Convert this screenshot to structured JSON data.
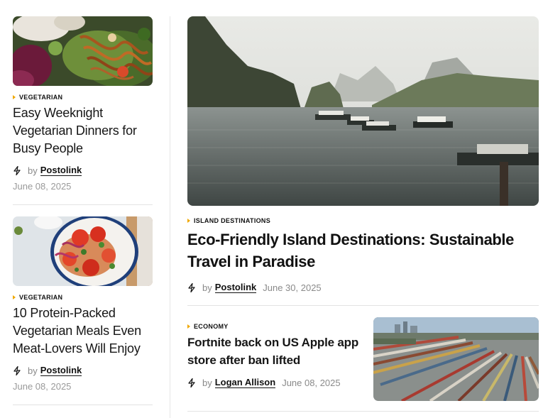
{
  "left_articles": [
    {
      "category": "VEGETARIAN",
      "title": "Easy Weeknight Vegetarian Dinners for Busy People",
      "by": "by",
      "author": "Postolink",
      "date": "June 08, 2025",
      "image": "noodle-salad-photo"
    },
    {
      "category": "VEGETARIAN",
      "title": "10 Protein-Packed Vegetarian Meals Even Meat-Lovers Will Enjoy",
      "by": "by",
      "author": "Postolink",
      "date": "June 08, 2025",
      "image": "tomato-salad-photo"
    }
  ],
  "featured": {
    "category": "ISLAND DESTINATIONS",
    "title": "Eco-Friendly Island Destinations: Sustainable Travel in Paradise",
    "by": "by",
    "author": "Postolink",
    "date": "June 30, 2025",
    "image": "island-bay-boats-photo"
  },
  "secondary": {
    "category": "ECONOMY",
    "title": "Fortnite back on US Apple app store after ban lifted",
    "by": "by",
    "author": "Logan Allison",
    "date": "June 08, 2025",
    "image": "rail-yard-aerial-photo"
  },
  "colors": {
    "accent": "#f0a800",
    "text": "#111111",
    "muted": "#8a8a8a",
    "divider": "#e3e3e3"
  },
  "icons": {
    "author_icon": "bolt-icon",
    "category_marker": "triangle-marker-icon"
  }
}
